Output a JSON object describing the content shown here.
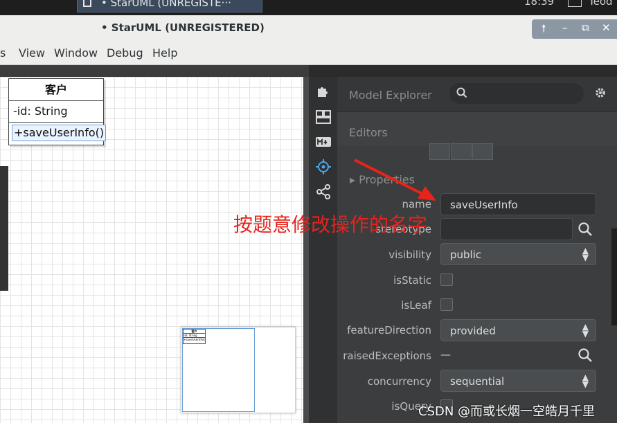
{
  "taskbar": {
    "task_label": "• StarUML (UNREGISTE···",
    "clock": "18:39",
    "user": "Teod"
  },
  "window": {
    "title": "• StarUML (UNREGISTERED)"
  },
  "menu": [
    "s",
    "View",
    "Window",
    "Debug",
    "Help"
  ],
  "diagram": {
    "class_name": "客户",
    "attribute": "-id: String",
    "operation": "+saveUserInfo()",
    "minimap_class": {
      "name": "客户",
      "attribute": "-id: String",
      "operation": "+saveUserInfo()"
    }
  },
  "panel": {
    "model_explorer_label": "Model Explorer",
    "editors_label": "Editors",
    "properties_label": "Properties",
    "fields": {
      "name": {
        "label": "name",
        "value": "saveUserInfo"
      },
      "stereotype": {
        "label": "stereotype",
        "value": ""
      },
      "visibility": {
        "label": "visibility",
        "value": "public"
      },
      "isStatic": {
        "label": "isStatic"
      },
      "isLeaf": {
        "label": "isLeaf"
      },
      "featureDirection": {
        "label": "featureDirection",
        "value": "provided"
      },
      "raisedExceptions": {
        "label": "raisedExceptions",
        "value": "—"
      },
      "concurrency": {
        "label": "concurrency",
        "value": "sequential"
      },
      "isQuery": {
        "label": "isQuery"
      }
    }
  },
  "annotation": {
    "text": "按题意修改操作的名字",
    "color": "#e8231c"
  },
  "watermark": "CSDN @而或长烟一空皓月千里"
}
